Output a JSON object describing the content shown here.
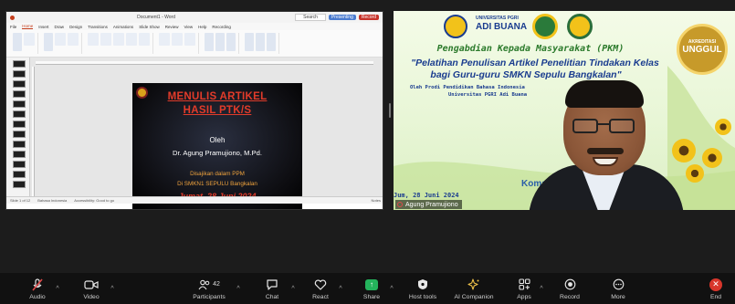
{
  "share": {
    "window_title": "Document1 - Word",
    "search_placeholder": "Search",
    "presenter_badge": "Presenting",
    "record_badge": "Record",
    "menu": [
      "File",
      "Home",
      "Insert",
      "Draw",
      "Design",
      "Transitions",
      "Animations",
      "Slide Show",
      "Review",
      "View",
      "Help",
      "Recording"
    ],
    "active_menu_index": 1,
    "slide": {
      "title_line1": "MENULIS ARTIKEL",
      "title_line2": "HASIL PTK/S",
      "oleh": "Oleh",
      "author": "Dr. Agung Pramujiono, M.Pd.",
      "note": "Disajikan dalam PPM",
      "place": "Di SMKN1 SEPULU Bangkalan",
      "date": "Jumat, 28 Juni 2024"
    },
    "status_left": "Slide 1 of 12",
    "status_lang": "Bahasa Indonesia",
    "status_access": "Accessibility: Good to go",
    "status_notes": "Notes"
  },
  "video": {
    "uni_small": "UNIVERSITAS PGRI",
    "uni_big": "ADI BUANA",
    "pkm": "Pengabdian Kepada Masyarakat (PKM)",
    "title_line1": "\"Pelatihan Penulisan Artikel Penelitian Tindakan Kelas",
    "title_line2": "bagi Guru-guru SMKN Sepulu Bangkalan\"",
    "org_line1": "Oleh Prodi Pendidikan Bahasa Indonesia",
    "org_line2": "Universitas PGRI Adi Buana",
    "accred_top": "AKREDITASI",
    "accred_main": "UNGGUL",
    "komaus": "Komaus",
    "date_strip": "Jum, 28 Juni 2024",
    "participant_name": "Agung Pramujiono"
  },
  "toolbar": {
    "audio": "Audio",
    "video": "Video",
    "participants": "Participants",
    "participants_count": "42",
    "chat": "Chat",
    "react": "React",
    "share": "Share",
    "host_tools": "Host tools",
    "ai_companion": "AI Companion",
    "apps": "Apps",
    "record": "Record",
    "more": "More",
    "end": "End"
  },
  "colors": {
    "share_green": "#24b35c",
    "end_red": "#d8362b",
    "slide_title_red": "#e23b2a",
    "slide_note_orange": "#f0a33c",
    "banner_blue": "#1a3c8f",
    "banner_green": "#2b7a2b"
  }
}
